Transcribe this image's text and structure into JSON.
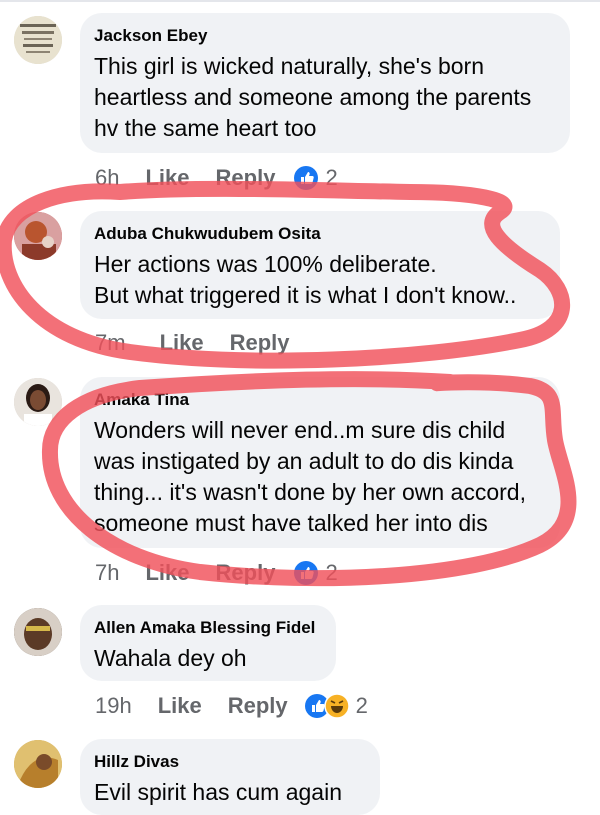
{
  "comments": [
    {
      "author": "Jackson Ebey",
      "text": "This girl is wicked naturally, she's born\nheartless and someone among the parents\nhv the same heart too",
      "time": "6h",
      "like": "Like",
      "reply": "Reply",
      "reactions": [
        "like"
      ],
      "reaction_count": "2",
      "avatar_text": "Ever your life. A lawyer A soldier ... But only GOD"
    },
    {
      "author": "Aduba Chukwudubem Osita",
      "text": "Her actions was 100% deliberate.\nBut what triggered it is what I don't know..",
      "time": "7m",
      "like": "Like",
      "reply": "Reply",
      "reactions": [],
      "reaction_count": ""
    },
    {
      "author": "Amaka Tina",
      "text": "Wonders will never end..m sure dis child\nwas instigated by an adult to do dis kinda\nthing... it's wasn't done by her own accord,\nsomeone must have talked her into dis",
      "time": "7h",
      "like": "Like",
      "reply": "Reply",
      "reactions": [
        "like"
      ],
      "reaction_count": "2"
    },
    {
      "author": "Allen Amaka Blessing Fidel",
      "text": "Wahala dey oh",
      "time": "19h",
      "like": "Like",
      "reply": "Reply",
      "reactions": [
        "like",
        "haha"
      ],
      "reaction_count": "2"
    },
    {
      "author": "Hillz Divas",
      "text": "Evil spirit has cum again",
      "time": "",
      "like": "",
      "reply": "",
      "reactions": [],
      "reaction_count": ""
    }
  ],
  "colors": {
    "bubble": "#f0f2f5",
    "meta": "#65676b",
    "like_blue": "#1877f2",
    "haha_yellow": "#f7b125",
    "annotation_red": "#f0505a"
  }
}
